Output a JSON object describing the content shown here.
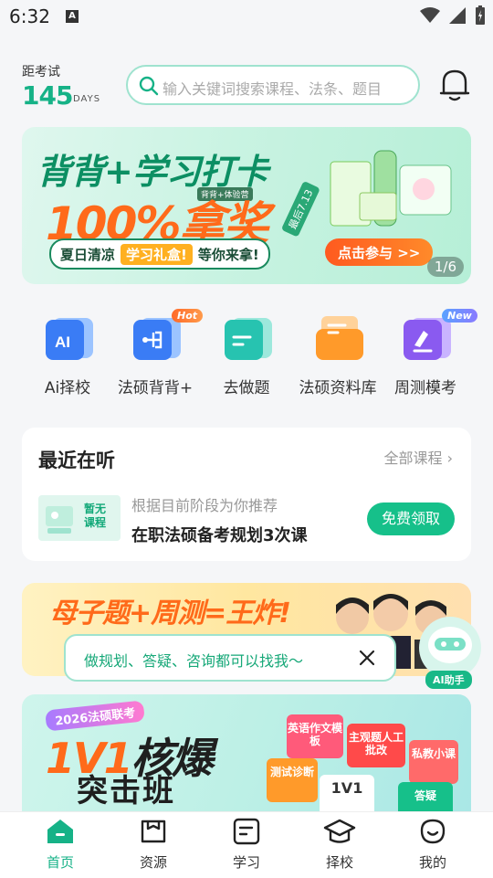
{
  "status_bar": {
    "time": "6:32",
    "a_icon": "A"
  },
  "header": {
    "countdown_label": "距考试",
    "countdown_value": "145",
    "countdown_unit": "DAYS",
    "search_placeholder": "输入关键词搜索课程、法条、题目"
  },
  "banner": {
    "title": "背背+学习打卡",
    "big_text": "100%拿奖",
    "tag": "背背+体验营",
    "date_tag": "最后7.13",
    "note_left": "夏日清凉",
    "note_gift": "学习礼盒!",
    "note_right": "等你来拿!",
    "cta": "点击参与 >>",
    "page": "1/6"
  },
  "quick_actions": [
    {
      "label": "Ai择校",
      "icon": "ai-school-icon"
    },
    {
      "label": "法硕背背+",
      "icon": "flashcard-icon",
      "badge": "Hot"
    },
    {
      "label": "去做题",
      "icon": "practice-icon"
    },
    {
      "label": "法硕资料库",
      "icon": "library-icon"
    },
    {
      "label": "周测模考",
      "icon": "mock-exam-icon",
      "badge": "New"
    }
  ],
  "recent": {
    "title": "最近在听",
    "all_link": "全部课程",
    "thumb_text_1": "暂无",
    "thumb_text_2": "课程",
    "description": "根据目前阶段为你推荐",
    "course": "在职法硕备考规划3次课",
    "button": "免费领取"
  },
  "promo": {
    "text": "母子题+周测=王炸!"
  },
  "tip": {
    "text": "做规划、答疑、咨询都可以找我～"
  },
  "ai_assistant": {
    "label": "AI助手"
  },
  "banner2": {
    "tag": "2026法硕联考",
    "title_accent": "1V1",
    "title": "核爆",
    "subtitle": "突击班",
    "cubes": [
      "英语作文模板",
      "主观题人工批改",
      "私教小课",
      "测试诊断",
      "1V1",
      "答疑"
    ]
  },
  "tabs": [
    {
      "label": "首页",
      "icon": "home-icon",
      "active": true
    },
    {
      "label": "资源",
      "icon": "resource-icon"
    },
    {
      "label": "学习",
      "icon": "study-icon"
    },
    {
      "label": "择校",
      "icon": "school-icon"
    },
    {
      "label": "我的",
      "icon": "profile-icon"
    }
  ],
  "colors": {
    "brand": "#16b287",
    "accent": "#ff6a1a",
    "button": "#16c08a"
  }
}
